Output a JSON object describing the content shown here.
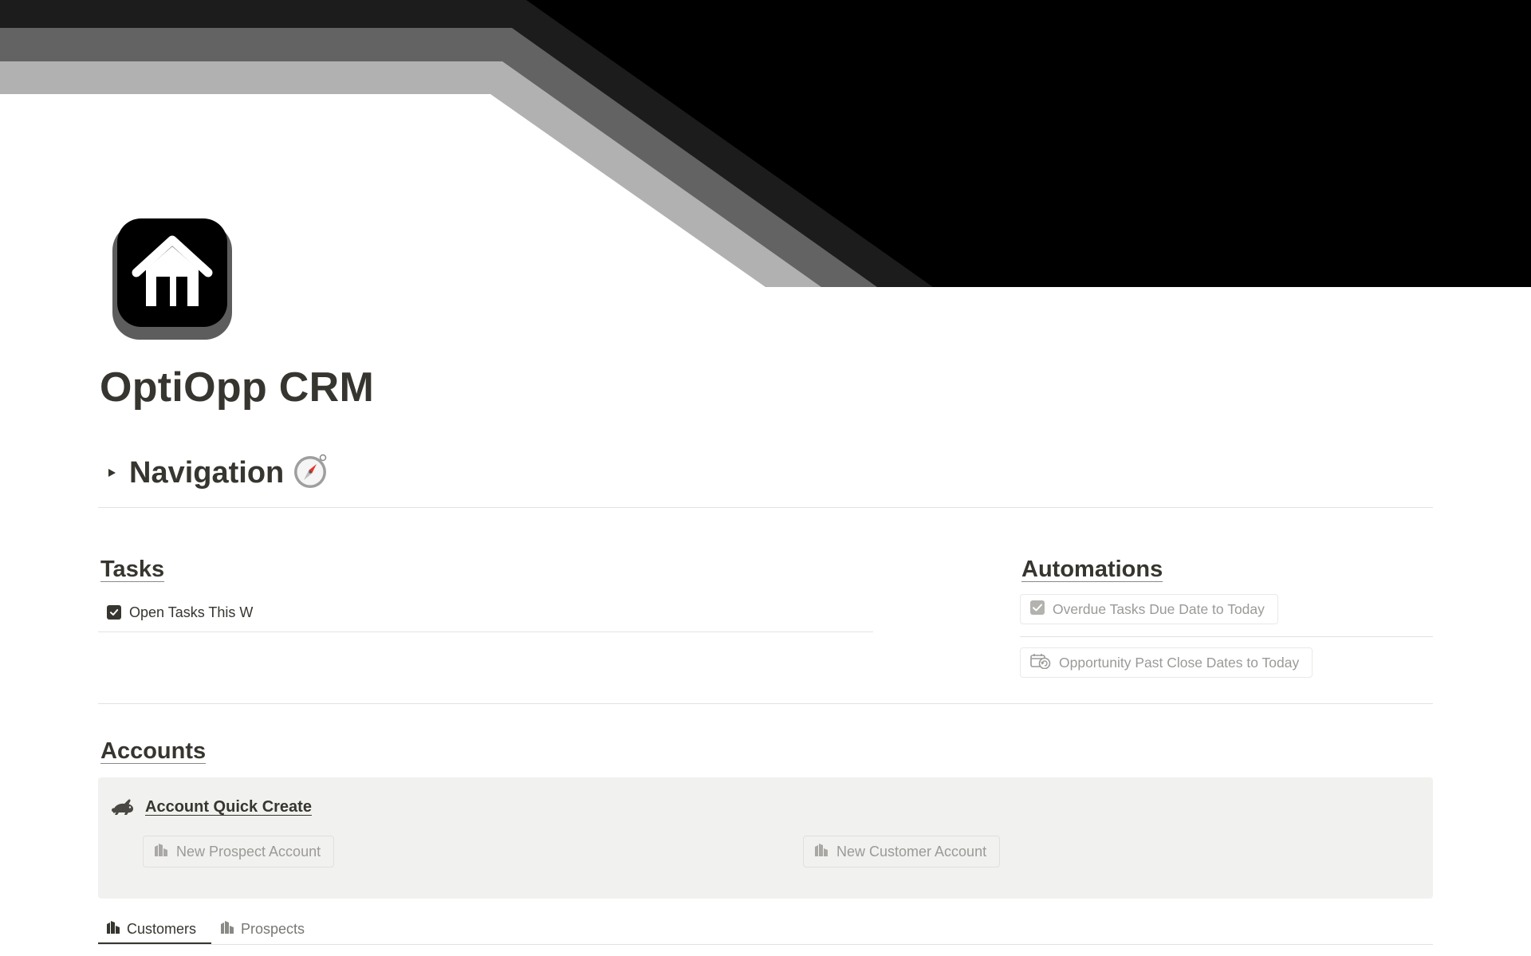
{
  "page": {
    "title": "OptiOpp CRM",
    "icon": "house-icon"
  },
  "navigation": {
    "label": "Navigation",
    "emoji_icon": "compass-icon",
    "toggle_icon": "triangle-right-icon"
  },
  "tasks": {
    "heading": "Tasks",
    "items": [
      {
        "label": "Open Tasks This W",
        "icon": "checkbox-icon"
      }
    ]
  },
  "automations": {
    "heading": "Automations",
    "buttons": [
      {
        "label": "Overdue Tasks Due Date to Today",
        "icon": "checkbox-icon"
      },
      {
        "label": "Opportunity Past Close Dates to Today",
        "icon": "calendar-refresh-icon"
      }
    ]
  },
  "accounts": {
    "heading": "Accounts",
    "callout": {
      "icon": "rabbit-icon",
      "title": "Account Quick Create",
      "buttons": [
        {
          "label": "New Prospect Account",
          "icon": "buildings-icon"
        },
        {
          "label": "New Customer Account",
          "icon": "buildings-icon"
        }
      ]
    },
    "tabs": [
      {
        "label": "Customers",
        "icon": "buildings-icon",
        "active": true
      },
      {
        "label": "Prospects",
        "icon": "buildings-icon",
        "active": false
      }
    ]
  },
  "colors": {
    "text": "#37352f",
    "muted_text": "#9b9a97",
    "callout_bg": "#f1f1ef",
    "divider": "#e3e2e0",
    "cover_black": "#000000",
    "cover_dark": "#1c1c1c",
    "cover_mid": "#636363",
    "cover_light": "#b1b1b1"
  }
}
